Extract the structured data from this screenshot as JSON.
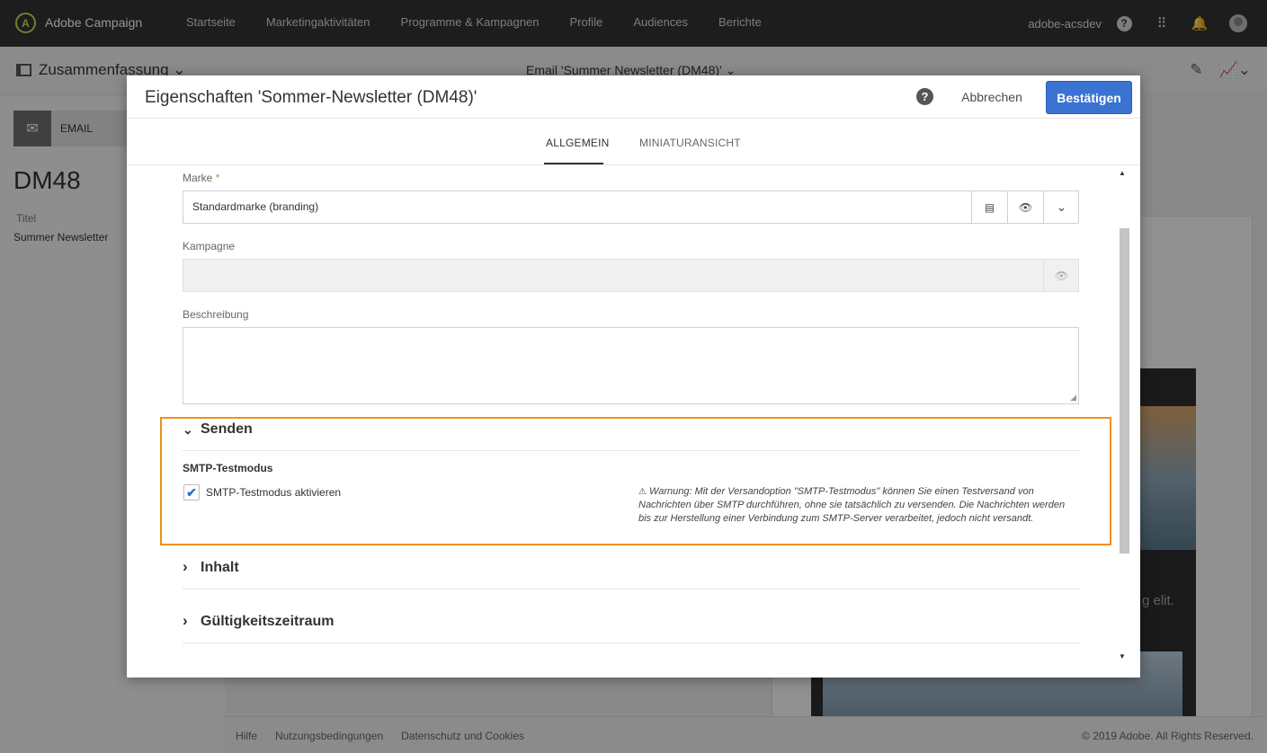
{
  "topbar": {
    "logo_glyph": "A",
    "app_name": "Adobe Campaign",
    "nav": [
      "Startseite",
      "Marketingaktivitäten",
      "Programme & Kampagnen",
      "Profile",
      "Audiences",
      "Berichte"
    ],
    "org": "adobe-acsdev",
    "help_glyph": "?",
    "apps_glyph": "⠿",
    "bell_glyph": "🔔"
  },
  "subbar": {
    "summary": "Zusammenfassung ⌄",
    "email_title": "Email 'Summer Newsletter (DM48)' ⌄",
    "edit_glyph": "✎",
    "report_glyph": "📈⌄"
  },
  "left": {
    "email_glyph": "✉",
    "email_label": "EMAIL",
    "code": "DM48",
    "title_label": "Titel",
    "title_value": "Summer Newsletter"
  },
  "background": {
    "preview_text": "g elit."
  },
  "footer": {
    "links": [
      "Hilfe",
      "Nutzungsbedingungen",
      "Datenschutz und Cookies"
    ],
    "copyright": "© 2019 Adobe. All Rights Reserved."
  },
  "modal": {
    "title": "Eigenschaften 'Sommer-Newsletter (DM48)'",
    "help_glyph": "?",
    "cancel": "Abbrechen",
    "confirm": "Bestätigen",
    "tabs": [
      "ALLGEMEIN",
      "MINIATURANSICHT"
    ],
    "fields": {
      "brand_label": "Marke",
      "required_mark": "*",
      "brand_value": "Standardmarke (branding)",
      "campaign_label": "Kampagne",
      "campaign_value": "",
      "description_label": "Beschreibung",
      "description_value": ""
    },
    "icons": {
      "folder": "▤",
      "eye": "👁",
      "chevron_down": "⌄",
      "section_open": "⌄",
      "section_closed": "›",
      "scroll_up": "▲",
      "scroll_down": "▼",
      "check": "✔",
      "warning": "⚠",
      "resize": "◢"
    },
    "sections": {
      "send": "Senden",
      "smtp_heading": "SMTP-Testmodus",
      "smtp_checkbox": "SMTP-Testmodus aktivieren",
      "smtp_checked": true,
      "warning": "Warnung: Mit der Versandoption \"SMTP-Testmodus\" können Sie einen Testversand von Nachrichten über SMTP durchführen, ohne sie tatsächlich zu versenden. Die Nachrichten werden bis zur Herstellung einer Verbindung zum SMTP-Server verarbeitet, jedoch nicht versandt.",
      "content": "Inhalt",
      "validity": "Gültigkeitszeitraum"
    }
  },
  "colors": {
    "topbar": "#323232",
    "accent_blue": "#3a73d2",
    "highlight_orange": "#f0901c",
    "required": "#e68619"
  }
}
